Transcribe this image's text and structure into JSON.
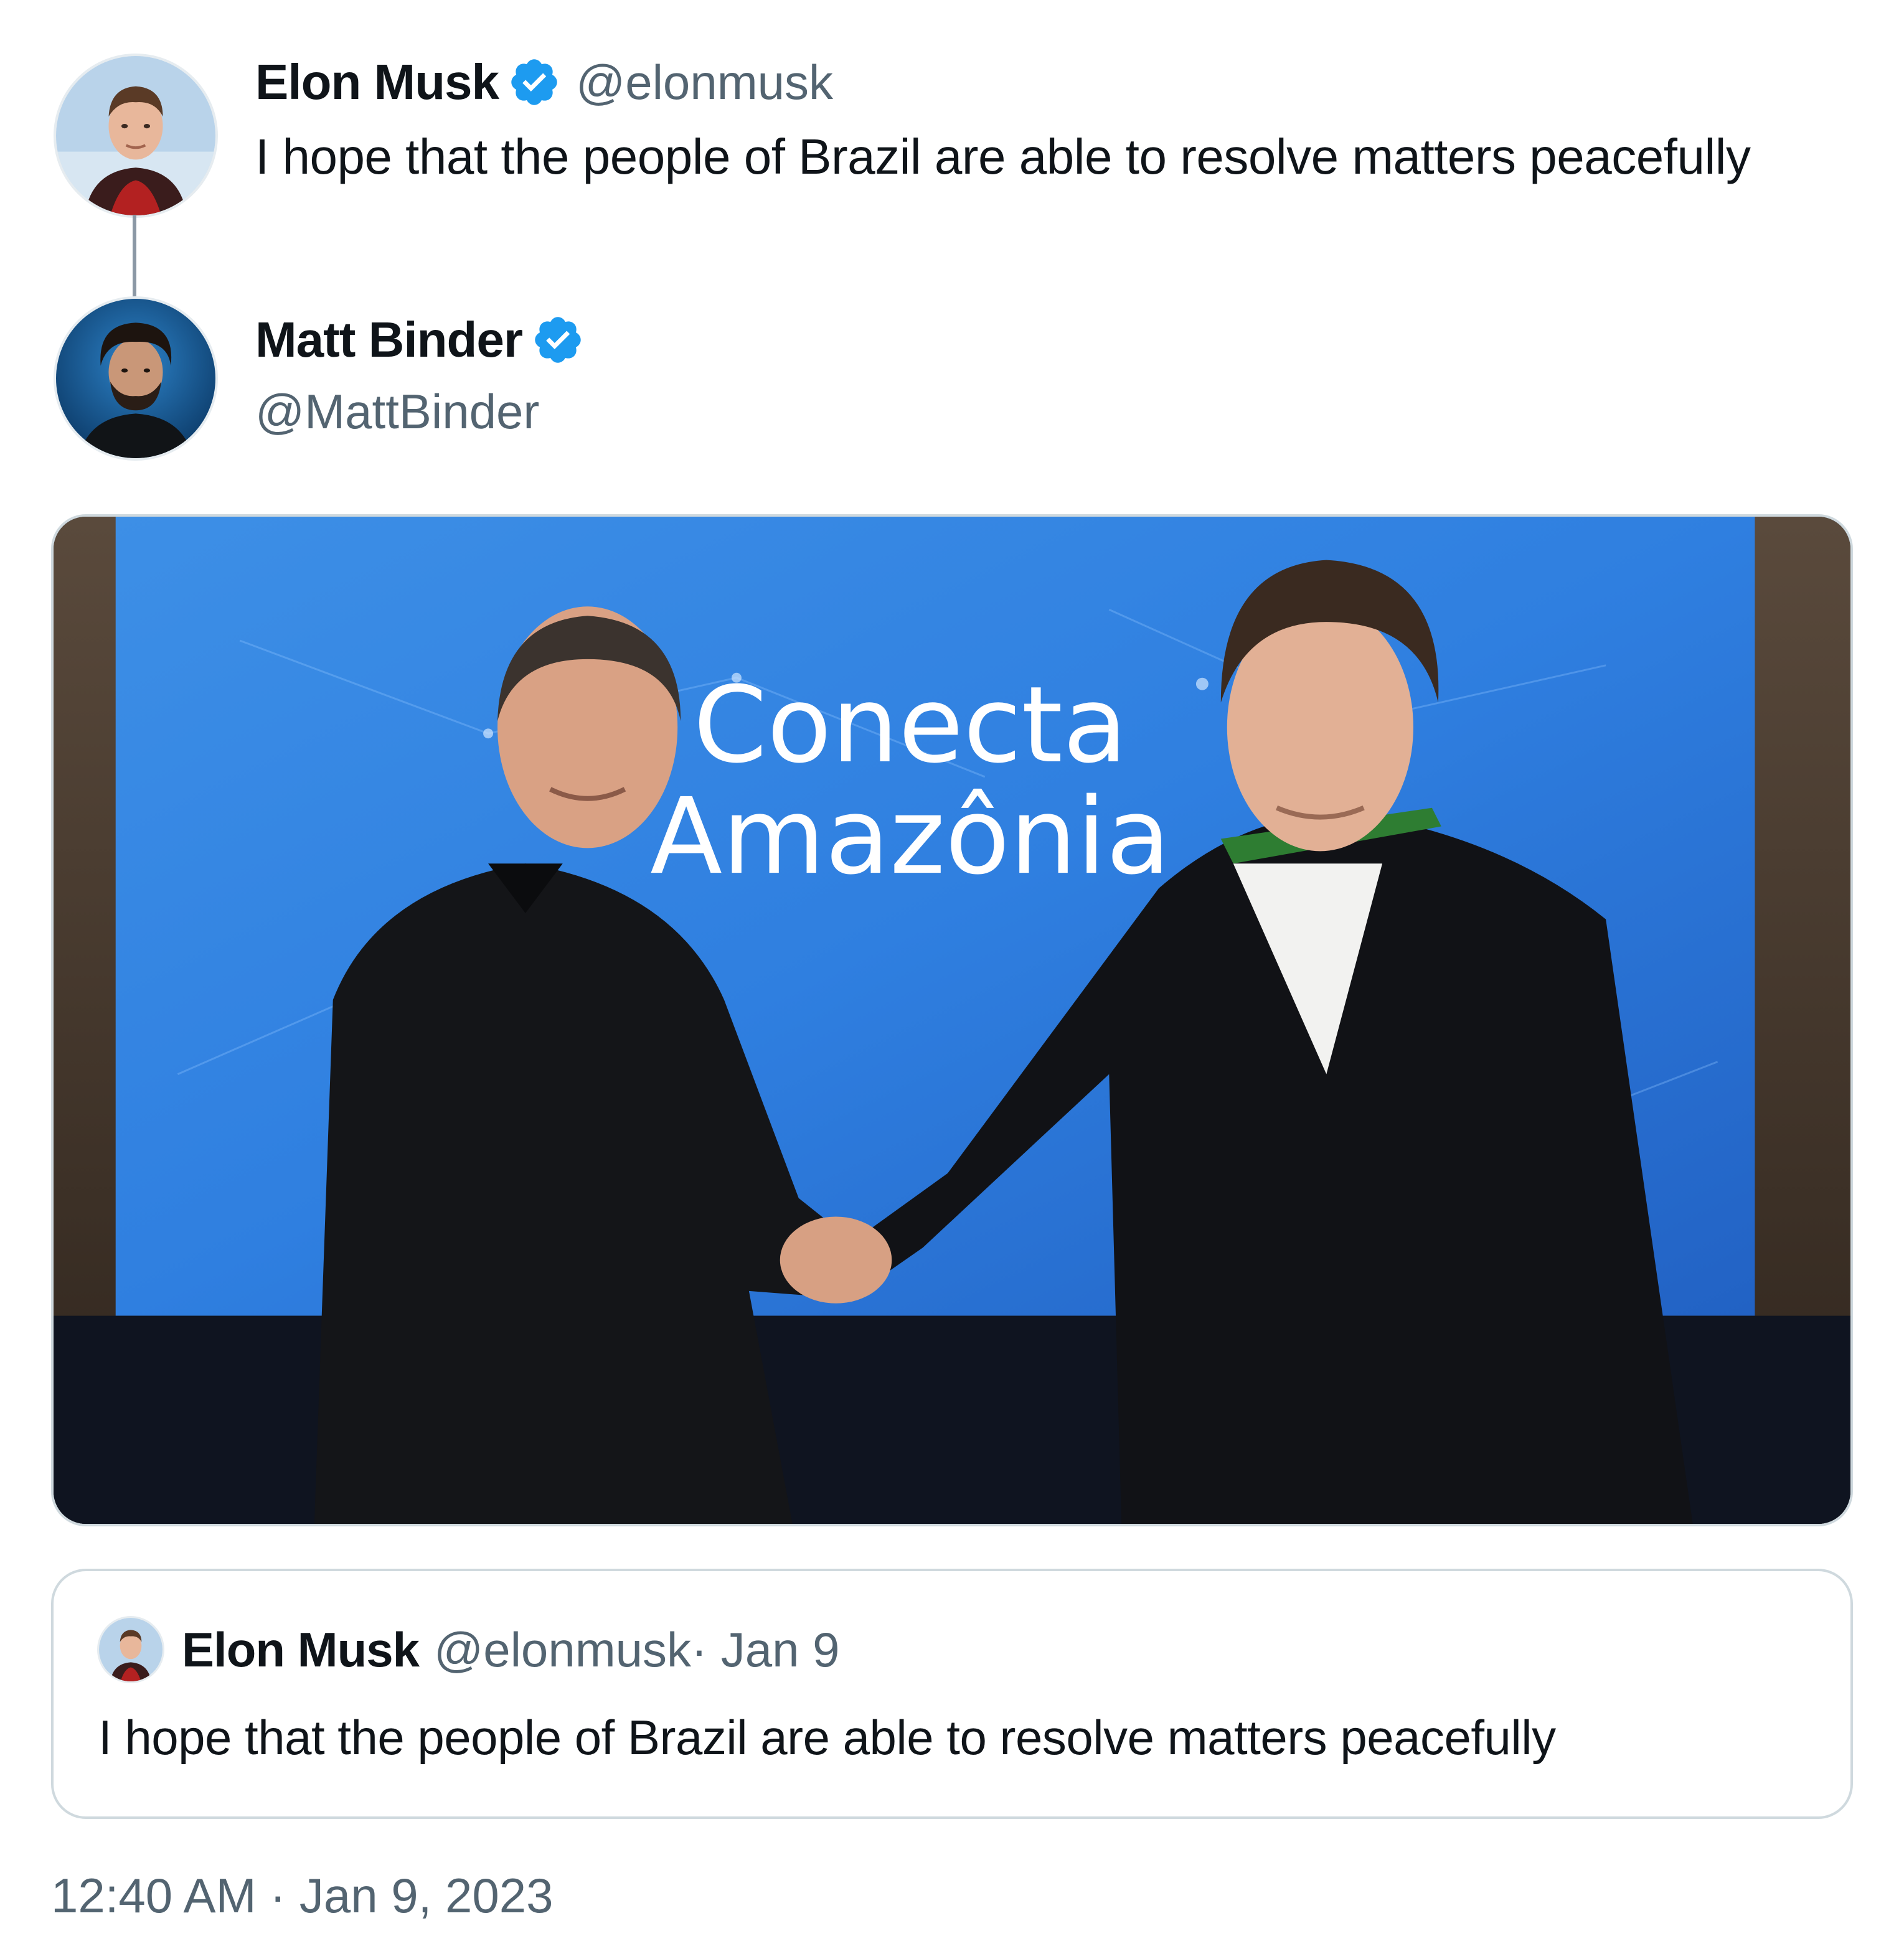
{
  "reply_tweet": {
    "author_name": "Elon Musk",
    "author_handle": "@elonmusk",
    "text": "I hope that the people of Brazil are able to resolve matters peacefully",
    "verified": true
  },
  "main_tweet": {
    "author_name": "Matt Binder",
    "author_handle": "@MattBinder",
    "verified": true,
    "media": {
      "sign_line1": "Conecta",
      "sign_line2": "Amazônia"
    },
    "timestamp": "12:40 AM · Jan 9, 2023"
  },
  "quoted_tweet": {
    "author_name": "Elon Musk",
    "author_handle_date": "@elonmusk· Jan 9",
    "text": "I hope that the people of Brazil are able to resolve matters peacefully"
  },
  "colors": {
    "verified_blue": "#1d9bf0",
    "secondary_text": "#536471",
    "border": "#cfd9de"
  },
  "icons": {
    "verified": "verified-badge-icon"
  }
}
